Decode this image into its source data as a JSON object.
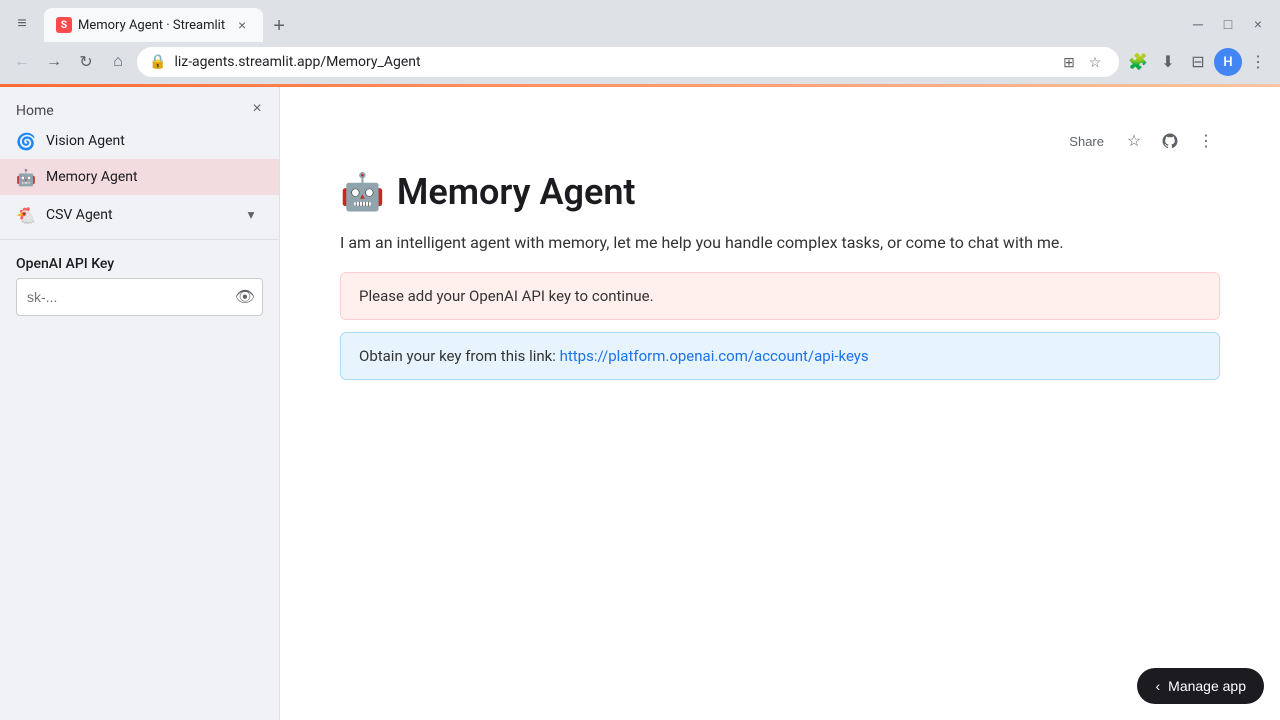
{
  "browser": {
    "tab_title": "Memory Agent · Streamlit",
    "tab_favicon": "S",
    "address": "liz-agents.streamlit.app/Memory_Agent",
    "new_tab_label": "+",
    "share_label": "Share"
  },
  "sidebar": {
    "close_icon": "×",
    "home_label": "Home",
    "items": [
      {
        "id": "vision-agent",
        "emoji": "🌀",
        "label": "Vision Agent",
        "active": false
      },
      {
        "id": "memory-agent",
        "emoji": "🤖",
        "label": "Memory Agent",
        "active": true
      },
      {
        "id": "csv-agent",
        "emoji": "🐔",
        "label": "CSV Agent",
        "active": false
      }
    ],
    "api_key_label": "OpenAI API Key",
    "api_key_placeholder": "sk-..."
  },
  "main": {
    "heading_emoji": "🤖",
    "heading_text": "Memory Agent",
    "subtitle": "I am an intelligent agent with memory, let me help you handle complex tasks, or come to chat with me.",
    "alert_warning": "Please add your OpenAI API key to continue.",
    "alert_info_prefix": "Obtain your key from this link: ",
    "alert_info_link_text": "https://platform.openai.com/account/api-keys",
    "alert_info_link_url": "https://platform.openai.com/account/api-keys"
  },
  "manage_app": {
    "label": "Manage app",
    "chevron": "‹"
  },
  "icons": {
    "back": "←",
    "forward": "→",
    "refresh": "↻",
    "home": "⌂",
    "translate": "⊞",
    "star": "☆",
    "extensions": "🧩",
    "download": "⬇",
    "sidebar_toggle": "⊟",
    "more": "⋮",
    "minimize": "─",
    "maximize": "□",
    "close": "×",
    "eye": "👁",
    "chevron_down": "▾"
  }
}
